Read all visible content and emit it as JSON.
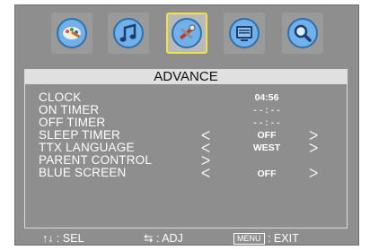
{
  "title": "ADVANCE",
  "rows": [
    {
      "label": "CLOCK",
      "value": "04:56"
    },
    {
      "label": "ON TIMER",
      "value": "- - : - -"
    },
    {
      "label": "OFF TIMER",
      "value": "- - : - -"
    },
    {
      "label": "SLEEP TIMER",
      "value": "OFF"
    },
    {
      "label": "TTX LANGUAGE",
      "value": "WEST"
    },
    {
      "label": "PARENT CONTROL"
    },
    {
      "label": "BLUE SCREEN",
      "value": "OFF"
    }
  ],
  "arrows": {
    "left": "ᐸ",
    "right": "ᐳ"
  },
  "menu_icons": [
    "picture-icon",
    "sound-icon",
    "advance-tools-icon",
    "tv-channel-icon",
    "search-icon"
  ],
  "selected_menu": 2,
  "hints": {
    "select_glyph": "↑↓",
    "select_label": ": SEL",
    "adjust_glyph": "⇆",
    "adjust_label": ": ADJ",
    "menu_key": "MENU",
    "menu_label": ": EXIT"
  }
}
